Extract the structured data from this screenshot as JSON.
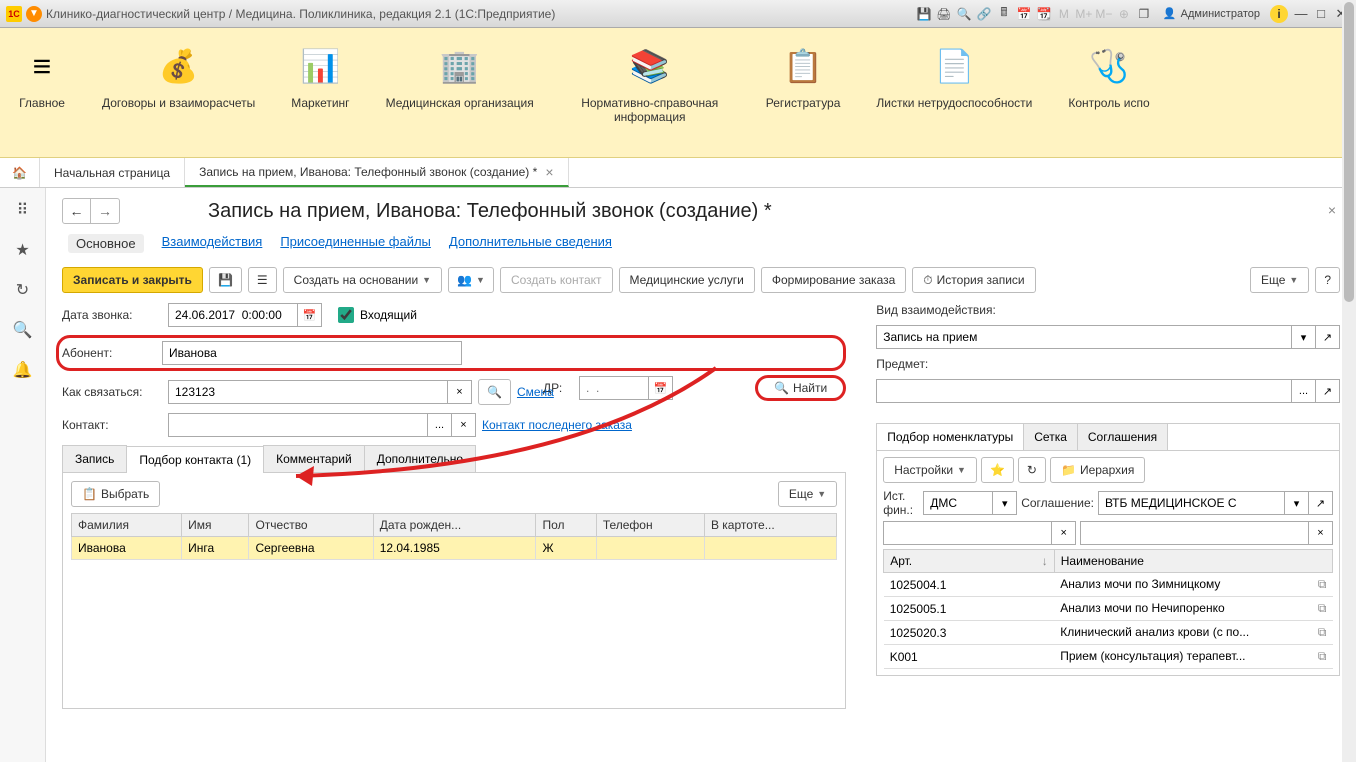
{
  "titlebar": {
    "app_title": "Клинико-диагностический центр / Медицина. Поликлиника, редакция 2.1  (1С:Предприятие)",
    "user": "Администратор"
  },
  "sections": [
    {
      "label": "Главное",
      "icon": "≡"
    },
    {
      "label": "Договоры и взаиморасчеты",
      "icon": "💰"
    },
    {
      "label": "Маркетинг",
      "icon": "📊"
    },
    {
      "label": "Медицинская организация",
      "icon": "🏢"
    },
    {
      "label": "Нормативно-справочная информация",
      "icon": "📚"
    },
    {
      "label": "Регистратура",
      "icon": "📋"
    },
    {
      "label": "Листки нетрудоспособности",
      "icon": "📄"
    },
    {
      "label": "Контроль испо",
      "icon": "🩺"
    }
  ],
  "tabs": {
    "home": "Начальная страница",
    "current": "Запись на прием, Иванова: Телефонный звонок (создание) *"
  },
  "page": {
    "title": "Запись на прием, Иванова: Телефонный звонок (создание) *",
    "subnav": [
      "Основное",
      "Взаимодействия",
      "Присоединенные файлы",
      "Дополнительные сведения"
    ]
  },
  "toolbar": {
    "save_close": "Записать и закрыть",
    "create_based": "Создать на основании",
    "create_contact": "Создать контакт",
    "med_services": "Медицинские услуги",
    "order_form": "Формирование заказа",
    "history": "История записи",
    "more": "Еще"
  },
  "form": {
    "date_label": "Дата звонка:",
    "date_value": "24.06.2017  0:00:00",
    "incoming_label": "Входящий",
    "abonent_label": "Абонент:",
    "abonent_value": "Иванова",
    "dr_label": "ДР:",
    "dr_placeholder": ".  .",
    "find_btn": "Найти",
    "contact_how_label": "Как связаться:",
    "contact_how_value": "123123",
    "smena_link": "Смена",
    "contact_label": "Контакт:",
    "contact_last_order": "Контакт последнего заказа",
    "interaction_type_label": "Вид взаимодействия:",
    "interaction_type_value": "Запись на прием",
    "subject_label": "Предмет:"
  },
  "subtabs": [
    "Запись",
    "Подбор контакта (1)",
    "Комментарий",
    "Дополнительно"
  ],
  "contact_panel": {
    "select_btn": "Выбрать",
    "more": "Еще",
    "columns": [
      "Фамилия",
      "Имя",
      "Отчество",
      "Дата рожден...",
      "Пол",
      "Телефон",
      "В картоте..."
    ],
    "rows": [
      {
        "surname": "Иванова",
        "name": "Инга",
        "patronymic": "Сергеевна",
        "dob": "12.04.1985",
        "sex": "Ж",
        "phone": "",
        "card": ""
      }
    ]
  },
  "right_panel": {
    "tabs": [
      "Подбор номенклатуры",
      "Сетка",
      "Соглашения"
    ],
    "settings_btn": "Настройки",
    "hierarchy_btn": "Иерархия",
    "fin_source_label": "Ист. фин.:",
    "fin_source_value": "ДМС",
    "agreement_label": "Соглашение:",
    "agreement_value": "ВТБ МЕДИЦИНСКОЕ С",
    "columns": [
      "Арт.",
      "Наименование"
    ],
    "rows": [
      {
        "art": "1025004.1",
        "name": "Анализ мочи по Зимницкому"
      },
      {
        "art": "1025005.1",
        "name": "Анализ мочи по Нечипоренко"
      },
      {
        "art": "1025020.3",
        "name": "Клинический анализ крови (с по..."
      },
      {
        "art": "K001",
        "name": "Прием (консультация) терапевт..."
      }
    ]
  }
}
